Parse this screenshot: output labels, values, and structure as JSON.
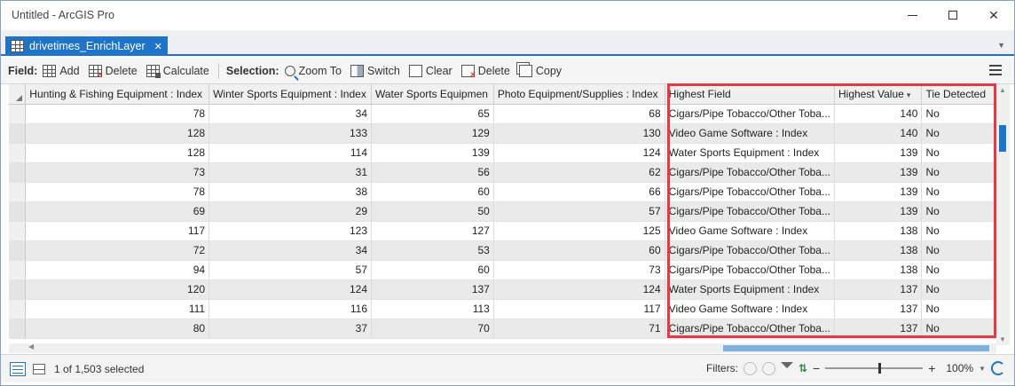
{
  "window": {
    "title": "Untitled - ArcGIS Pro"
  },
  "tab": {
    "label": "drivetimes_EnrichLayer"
  },
  "toolbar": {
    "field_label": "Field:",
    "add": "Add",
    "delete": "Delete",
    "calculate": "Calculate",
    "selection_label": "Selection:",
    "zoom_to": "Zoom To",
    "switch": "Switch",
    "clear": "Clear",
    "sel_delete": "Delete",
    "copy": "Copy"
  },
  "table": {
    "columns": [
      "Hunting & Fishing Equipment : Index",
      "Winter Sports Equipment : Index",
      "Water Sports Equipmen",
      "Photo Equipment/Supplies : Index",
      "Highest Field",
      "Highest Value",
      "Tie Detected"
    ],
    "rows": [
      [
        "78",
        "34",
        "65",
        "68",
        "Cigars/Pipe Tobacco/Other Toba...",
        "140",
        "No"
      ],
      [
        "128",
        "133",
        "129",
        "130",
        "Video Game Software : Index",
        "140",
        "No"
      ],
      [
        "128",
        "114",
        "139",
        "124",
        "Water Sports Equipment : Index",
        "139",
        "No"
      ],
      [
        "73",
        "31",
        "56",
        "62",
        "Cigars/Pipe Tobacco/Other Toba...",
        "139",
        "No"
      ],
      [
        "78",
        "38",
        "60",
        "66",
        "Cigars/Pipe Tobacco/Other Toba...",
        "139",
        "No"
      ],
      [
        "69",
        "29",
        "50",
        "57",
        "Cigars/Pipe Tobacco/Other Toba...",
        "139",
        "No"
      ],
      [
        "117",
        "123",
        "127",
        "125",
        "Video Game Software : Index",
        "138",
        "No"
      ],
      [
        "72",
        "34",
        "53",
        "60",
        "Cigars/Pipe Tobacco/Other Toba...",
        "138",
        "No"
      ],
      [
        "94",
        "57",
        "60",
        "73",
        "Cigars/Pipe Tobacco/Other Toba...",
        "138",
        "No"
      ],
      [
        "120",
        "124",
        "137",
        "124",
        "Water Sports Equipment : Index",
        "137",
        "No"
      ],
      [
        "111",
        "116",
        "113",
        "117",
        "Video Game Software : Index",
        "137",
        "No"
      ],
      [
        "80",
        "37",
        "70",
        "71",
        "Cigars/Pipe Tobacco/Other Toba...",
        "137",
        "No"
      ]
    ]
  },
  "status": {
    "selection_count": "1 of 1,503 selected",
    "filters_label": "Filters:",
    "zoom_level": "100%"
  },
  "colors": {
    "accent": "#1e74c8",
    "highlight": "#e23a4a"
  }
}
